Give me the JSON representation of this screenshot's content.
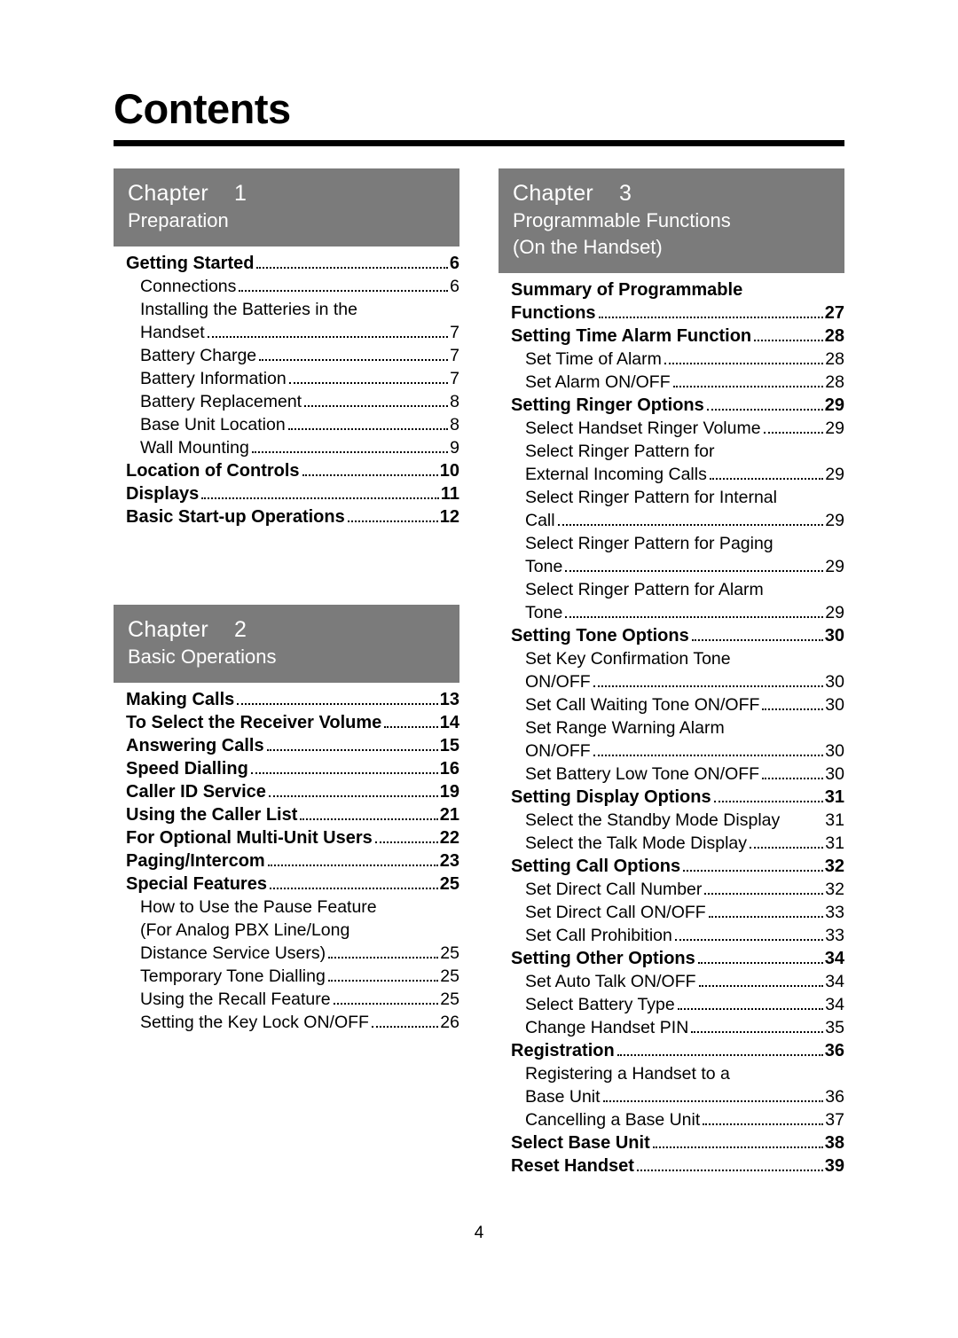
{
  "page": {
    "heading": "Contents",
    "page_number": "4"
  },
  "left_column": {
    "chapter1": {
      "label": "Chapter",
      "number": "1",
      "subtitle": "Preparation",
      "entries": [
        {
          "text": "Getting Started",
          "page": "6",
          "style": "bold"
        },
        {
          "text": "Connections",
          "page": "6",
          "style": "sub"
        },
        {
          "text": "Installing the Batteries in the",
          "page": "",
          "style": "plain"
        },
        {
          "text": "Handset",
          "page": "7",
          "style": "sub"
        },
        {
          "text": "Battery Charge",
          "page": "7",
          "style": "sub"
        },
        {
          "text": "Battery Information",
          "page": "7",
          "style": "sub"
        },
        {
          "text": "Battery Replacement",
          "page": "8",
          "style": "sub"
        },
        {
          "text": "Base Unit Location",
          "page": "8",
          "style": "sub"
        },
        {
          "text": "Wall Mounting",
          "page": "9",
          "style": "sub"
        },
        {
          "text": "Location of Controls",
          "page": "10",
          "style": "bold"
        },
        {
          "text": "Displays",
          "page": "11",
          "style": "bold"
        },
        {
          "text": "Basic Start-up Operations",
          "page": "12",
          "style": "bold"
        }
      ]
    },
    "chapter2": {
      "label": "Chapter",
      "number": "2",
      "subtitle": "Basic Operations",
      "entries": [
        {
          "text": "Making Calls",
          "page": "13",
          "style": "bold"
        },
        {
          "text": "To Select the Receiver Volume",
          "page": "14",
          "style": "bold"
        },
        {
          "text": "Answering Calls",
          "page": "15",
          "style": "bold"
        },
        {
          "text": "Speed Dialling",
          "page": "16",
          "style": "bold"
        },
        {
          "text": "Caller ID Service",
          "page": "19",
          "style": "bold"
        },
        {
          "text": "Using the Caller List",
          "page": "21",
          "style": "bold"
        },
        {
          "text": "For Optional Multi-Unit Users",
          "page": "22",
          "style": "bold"
        },
        {
          "text": "Paging/Intercom",
          "page": "23",
          "style": "bold"
        },
        {
          "text": "Special Features",
          "page": "25",
          "style": "bold"
        },
        {
          "text": "How to Use the Pause Feature",
          "page": "",
          "style": "plain"
        },
        {
          "text": "(For Analog PBX Line/Long",
          "page": "",
          "style": "plain"
        },
        {
          "text": "Distance Service Users)",
          "page": "25",
          "style": "sub"
        },
        {
          "text": "Temporary Tone Dialling",
          "page": "25",
          "style": "sub"
        },
        {
          "text": "Using the Recall Feature",
          "page": "25",
          "style": "sub"
        },
        {
          "text": "Setting the Key Lock ON/OFF",
          "page": "26",
          "style": "sub"
        }
      ]
    }
  },
  "right_column": {
    "chapter3": {
      "label": "Chapter",
      "number": "3",
      "subtitle_line1": "Programmable Functions",
      "subtitle_line2": "(On the Handset)",
      "entries": [
        {
          "text": "Summary of Programmable",
          "page": "",
          "style": "plain-bold"
        },
        {
          "text": "Functions",
          "page": "27",
          "style": "bold"
        },
        {
          "text": "Setting Time Alarm Function",
          "page": "28",
          "style": "bold"
        },
        {
          "text": "Set Time of Alarm",
          "page": "28",
          "style": "sub"
        },
        {
          "text": "Set Alarm ON/OFF",
          "page": "28",
          "style": "sub"
        },
        {
          "text": "Setting Ringer Options",
          "page": "29",
          "style": "bold"
        },
        {
          "text": "Select Handset Ringer Volume",
          "page": "29",
          "style": "sub"
        },
        {
          "text": "Select Ringer Pattern for",
          "page": "",
          "style": "plain"
        },
        {
          "text": "External Incoming Calls",
          "page": "29",
          "style": "sub"
        },
        {
          "text": "Select Ringer Pattern for Internal",
          "page": "",
          "style": "plain"
        },
        {
          "text": "Call",
          "page": "29",
          "style": "sub"
        },
        {
          "text": "Select Ringer Pattern for Paging",
          "page": "",
          "style": "plain"
        },
        {
          "text": "Tone",
          "page": "29",
          "style": "sub"
        },
        {
          "text": "Select Ringer Pattern for Alarm",
          "page": "",
          "style": "plain"
        },
        {
          "text": "Tone",
          "page": "29",
          "style": "sub"
        },
        {
          "text": "Setting Tone Options",
          "page": "30",
          "style": "bold"
        },
        {
          "text": "Set Key Confirmation Tone",
          "page": "",
          "style": "plain"
        },
        {
          "text": "ON/OFF",
          "page": "30",
          "style": "sub"
        },
        {
          "text": "Set Call Waiting Tone ON/OFF",
          "page": "30",
          "style": "sub"
        },
        {
          "text": "Set Range Warning Alarm",
          "page": "",
          "style": "plain"
        },
        {
          "text": "ON/OFF",
          "page": "30",
          "style": "sub"
        },
        {
          "text": "Set Battery Low Tone ON/OFF",
          "page": "30",
          "style": "sub"
        },
        {
          "text": "Setting Display Options",
          "page": "31",
          "style": "bold"
        },
        {
          "text": "Select the Standby Mode Display",
          "page": "31",
          "style": "nodots"
        },
        {
          "text": "Select the Talk Mode Display",
          "page": "31",
          "style": "sub"
        },
        {
          "text": "Setting Call Options",
          "page": "32",
          "style": "bold"
        },
        {
          "text": "Set Direct Call Number",
          "page": "32",
          "style": "sub"
        },
        {
          "text": "Set Direct Call ON/OFF",
          "page": "33",
          "style": "sub"
        },
        {
          "text": "Set Call Prohibition",
          "page": "33",
          "style": "sub"
        },
        {
          "text": "Setting Other Options",
          "page": "34",
          "style": "bold"
        },
        {
          "text": "Set Auto Talk ON/OFF",
          "page": "34",
          "style": "sub"
        },
        {
          "text": "Select Battery Type",
          "page": "34",
          "style": "sub"
        },
        {
          "text": "Change Handset PIN",
          "page": "35",
          "style": "sub"
        },
        {
          "text": "Registration",
          "page": "36",
          "style": "bold"
        },
        {
          "text": "Registering a Handset to a",
          "page": "",
          "style": "plain"
        },
        {
          "text": "Base Unit",
          "page": "36",
          "style": "sub"
        },
        {
          "text": "Cancelling a Base Unit",
          "page": "37",
          "style": "sub"
        },
        {
          "text": "Select Base Unit",
          "page": "38",
          "style": "bold"
        },
        {
          "text": "Reset Handset",
          "page": "39",
          "style": "bold"
        }
      ]
    }
  }
}
